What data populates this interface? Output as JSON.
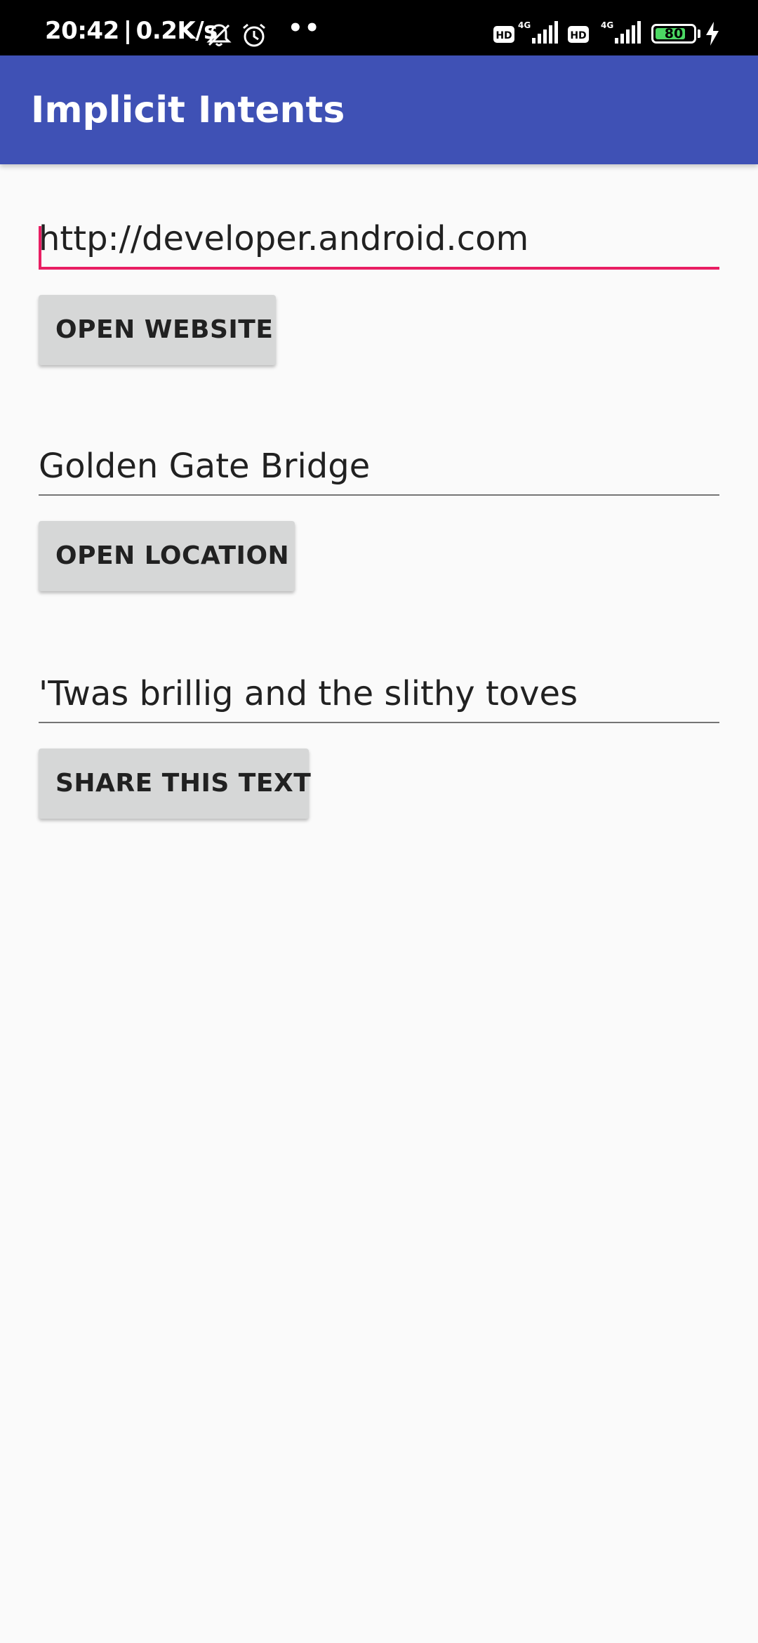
{
  "status_bar": {
    "time": "20:42",
    "separator": "|",
    "network_speed": "0.2K/s",
    "dots": "••",
    "battery_level": "80",
    "battery_fraction": 0.8,
    "icons": [
      "notifications-muted-icon",
      "alarm-icon",
      "hd-icon",
      "signal-4g-icon",
      "hd-icon",
      "signal-4g-icon",
      "battery-icon",
      "charging-icon"
    ]
  },
  "app_bar": {
    "title": "Implicit Intents",
    "color": "#3f51b5"
  },
  "website": {
    "value": "http://developer.android.com",
    "button_label": "OPEN WEBSITE"
  },
  "location": {
    "value": "Golden Gate Bridge",
    "button_label": "OPEN LOCATION"
  },
  "share": {
    "value": "'Twas brillig and the slithy toves",
    "button_label": "SHARE THIS TEXT"
  },
  "colors": {
    "accent": "#e91e63",
    "background": "#fafafa",
    "button": "#d6d7d7"
  }
}
